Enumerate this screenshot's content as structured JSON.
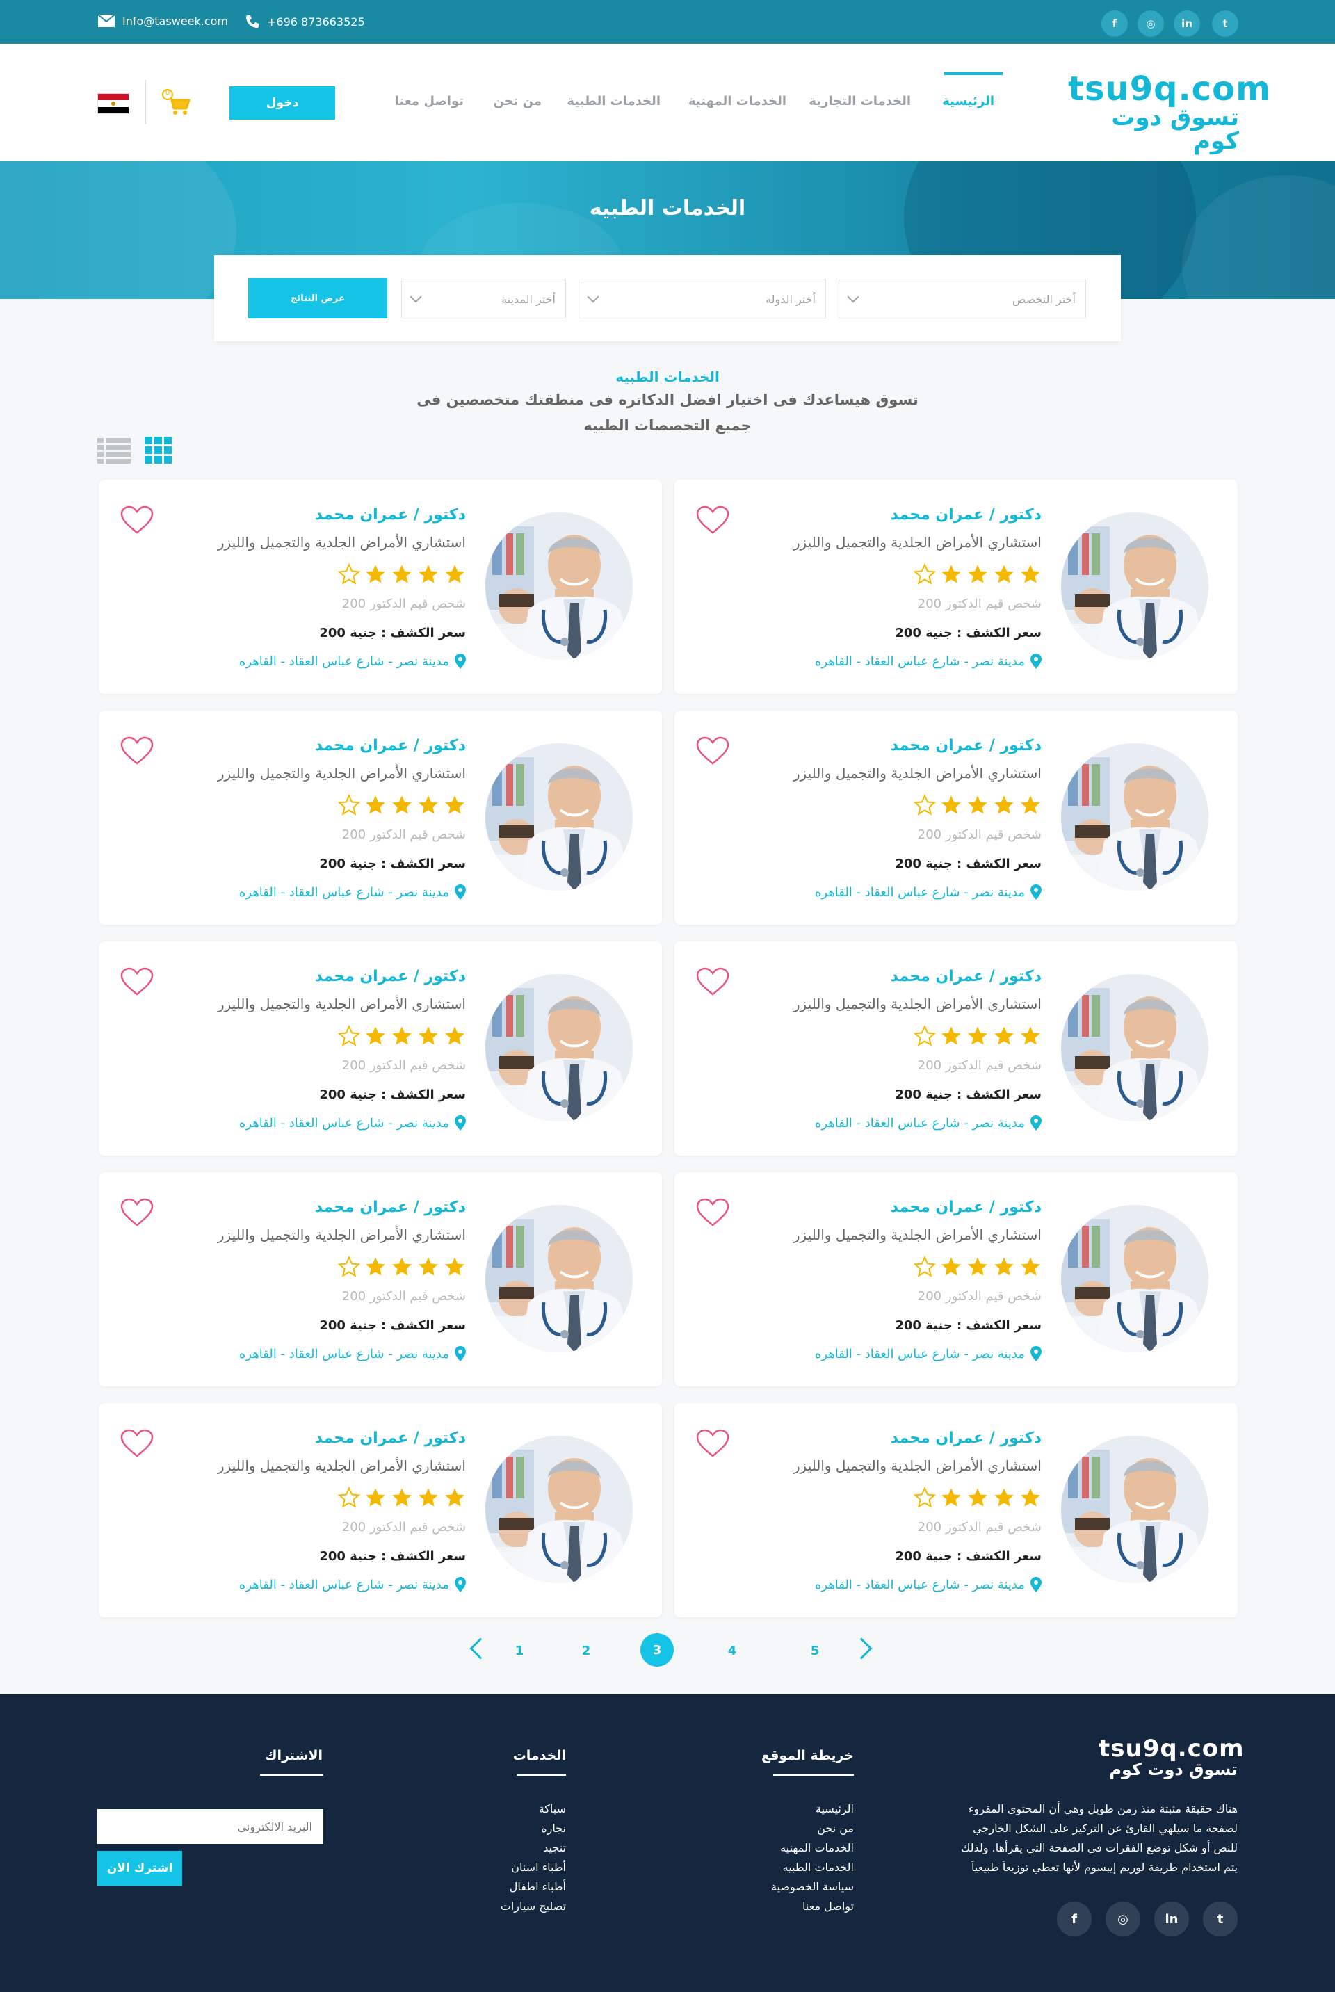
{
  "topbar": {
    "email": "Info@tasweek.com",
    "phone": "+696 873663525",
    "social": [
      {
        "name": "facebook-icon",
        "label": "f"
      },
      {
        "name": "instagram-icon",
        "label": "◎"
      },
      {
        "name": "linkedin-icon",
        "label": "in"
      },
      {
        "name": "twitter-icon",
        "label": "t"
      }
    ]
  },
  "header": {
    "logo_en": "tsu9q.com",
    "logo_ar": "تسوق دوت كوم",
    "nav": [
      "الرئيسية",
      "الخدمات التجارية",
      "الخدمات المهنية",
      "الخدمات الطبية",
      "من نحن",
      "تواصل معنا"
    ],
    "login_label": "دخول",
    "cart_count": "0"
  },
  "banner": {
    "title": "الخدمات الطبيه"
  },
  "search": {
    "specialty_placeholder": "أختر التخصص",
    "country_placeholder": "أختر الدولة",
    "city_placeholder": "أختر المدينة",
    "results_label": "عرض النتائج"
  },
  "intro": {
    "title": "الخدمات الطبيه",
    "line1": "تسوق هيساعدك فى اختيار افضل الدكاتره فى منطقتك متخصصين فى",
    "line2": "جميع التخصصات الطبيه"
  },
  "doctor": {
    "name": "دكتور / عمران محمد",
    "specialty": "استشاري الأمراض الجلدية والتجميل والليزر",
    "rating_value": 4,
    "rating_max": 5,
    "rating_text": "شخص قيم الدكتور 200",
    "price": "سعر الكشف : جنية 200",
    "address": "مدينة نصر - شارع عباس العقاد - القاهره"
  },
  "cards_count": 10,
  "pagination": {
    "pages": [
      "1",
      "2",
      "3",
      "4",
      "5"
    ],
    "current": "3"
  },
  "footer": {
    "logo_en": "tsu9q.com",
    "logo_ar": "تسوق دوت كوم",
    "about": [
      "هناك حقيقة مثبتة منذ زمن طويل وهي أن المحتوى المقروء",
      "لصفحة ما سيلهي القارئ عن التركيز على الشكل الخارجي",
      "للنص أو شكل توضع الفقرات في الصفحة التي يقرأها. ولذلك",
      "يتم استخدام طريقة لوريم إيبسوم لأنها تعطي توزيعاَ طبيعياَ"
    ],
    "sitemap_title": "خريطة الموقع",
    "sitemap_links": [
      "الرئيسية",
      "من نحن",
      "الخدمات المهنيه",
      "الخدمات الطبيه",
      "سياسة الخصوصية",
      "تواصل معنا"
    ],
    "services_title": "الخدمات",
    "services_links": [
      "سباكة",
      "نجارة",
      "تنجيد",
      "أطباء اسنان",
      "أطباء اطفال",
      "تصليح سيارات"
    ],
    "subscribe_title": "الاشتراك",
    "email_placeholder": "البريد الالكتروني",
    "subscribe_label": "اشترك الان",
    "social": [
      {
        "name": "facebook-icon",
        "label": "f"
      },
      {
        "name": "instagram-icon",
        "label": "◎"
      },
      {
        "name": "linkedin-icon",
        "label": "in"
      },
      {
        "name": "twitter-icon",
        "label": "t"
      }
    ]
  },
  "colors": {
    "accent": "#14c3e6",
    "topbar": "#1a8aa2",
    "footer": "#15263f",
    "star": "#f5b800",
    "heart": "#e8547d"
  }
}
